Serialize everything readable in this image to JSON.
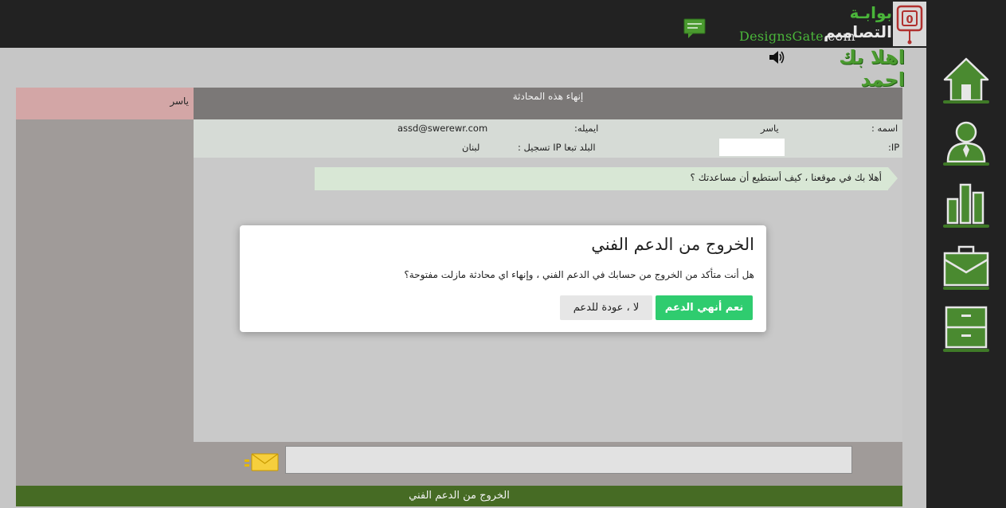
{
  "header": {
    "logo_word_1": "بوابـة",
    "logo_word_2": "التصاميم",
    "logo_en_brand": "DesignsGate",
    "logo_en_tld": ".com"
  },
  "greeting": "اهلا بك احمد",
  "session": {
    "user_name": "ياسر",
    "end_chat_label": "إنهاء هذه المحادثة"
  },
  "visitor_info": {
    "name_label": "اسمه :",
    "name_value": "ياسر",
    "email_label": "ايميله:",
    "email_value": "assd@swerewr.com",
    "ip_label": "IP:",
    "ip_value": "",
    "country_label": "البلد تبعا IP تسجيل :",
    "country_value": "لبنان"
  },
  "messages": [
    {
      "text": "أهلا بك في موقعنا ، كيف أستطيع أن مساعدتك ؟"
    }
  ],
  "composer": {
    "placeholder": ""
  },
  "footer": {
    "logout_label": "الخروج من الدعم الفني"
  },
  "modal": {
    "title": "الخروج من الدعم الفني",
    "body": "هل أنت متأكد من الخروج من حسابك في الدعم الفني ، وإنهاء اي محادثة مازلت مفتوحة؟",
    "confirm_label": "نعم أنهي الدعم",
    "cancel_label": "لا ، عودة للدعم"
  },
  "sidebar": {
    "items": [
      {
        "icon": "home-icon"
      },
      {
        "icon": "user-icon"
      },
      {
        "icon": "stats-icon"
      },
      {
        "icon": "briefcase-icon"
      },
      {
        "icon": "archive-icon"
      }
    ]
  },
  "colors": {
    "brand_green": "#4ab53a",
    "footer_green": "#466b24",
    "confirm_green": "#2fcc6f",
    "user_cell_pink": "#d3a6a6"
  }
}
